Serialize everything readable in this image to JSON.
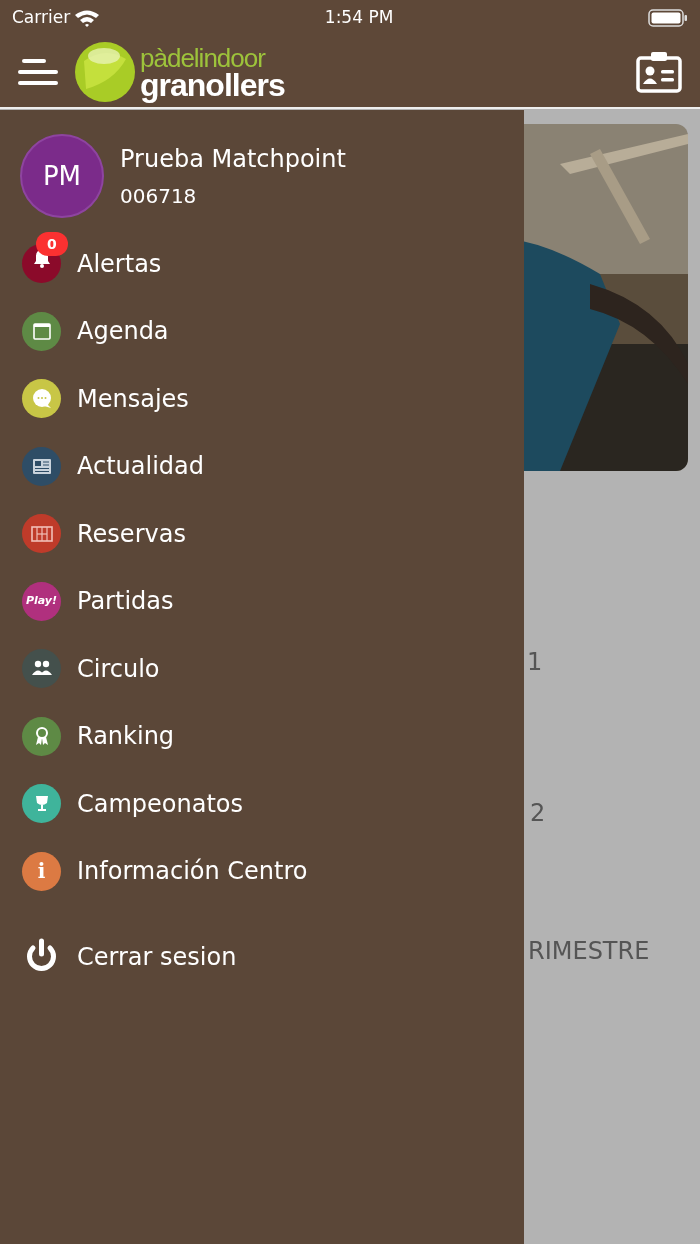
{
  "status_bar": {
    "carrier": "Carrier",
    "time": "1:54 PM"
  },
  "header": {
    "logo_top": "pàdelindoor",
    "logo_bottom": "granollers"
  },
  "background": {
    "texts": [
      "1",
      "2",
      "RIMESTRE"
    ]
  },
  "drawer": {
    "profile": {
      "initials": "PM",
      "name": "Prueba Matchpoint",
      "number": "006718"
    },
    "items": [
      {
        "label": "Alertas",
        "kind": "bell",
        "color": "#8b0a2a",
        "badge": "0"
      },
      {
        "label": "Agenda",
        "kind": "calendar",
        "color": "#5e8a45"
      },
      {
        "label": "Mensajes",
        "kind": "chat",
        "color": "#c8c646"
      },
      {
        "label": "Actualidad",
        "kind": "news",
        "color": "#2e4d66"
      },
      {
        "label": "Reservas",
        "kind": "court",
        "color": "#bf3b2a"
      },
      {
        "label": "Partidas",
        "kind": "play",
        "color": "#b0307e",
        "icon_text": "Play!"
      },
      {
        "label": "Circulo",
        "kind": "people",
        "color": "#44504c"
      },
      {
        "label": "Ranking",
        "kind": "medal",
        "color": "#5e8a45"
      },
      {
        "label": "Campeonatos",
        "kind": "trophy",
        "color": "#3fb49b"
      },
      {
        "label": "Información Centro",
        "kind": "info",
        "color": "#dc7a43",
        "icon_text": "i"
      }
    ],
    "logout": {
      "label": "Cerrar sesion"
    }
  }
}
